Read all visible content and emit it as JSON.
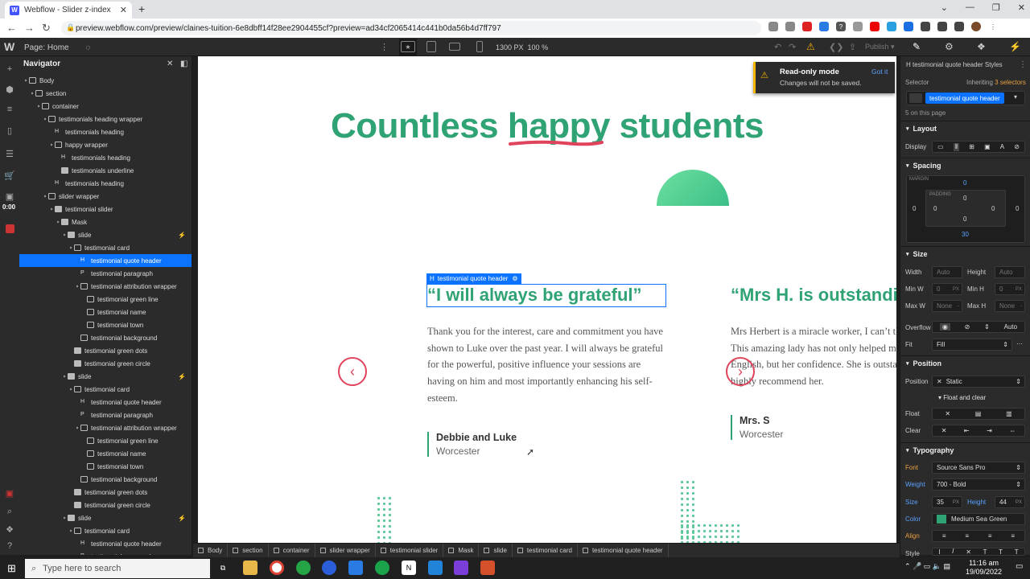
{
  "browser": {
    "tab_title": "Webflow - Slider z-index",
    "url": "preview.webflow.com/preview/claines-tuition-6e8dbff14f28ee2904455cf?preview=ad34cf2065414c441b0da56b4d7ff797"
  },
  "webflow": {
    "page_prefix": "Page:",
    "page_name": "Home",
    "viewport_width": "1300 PX",
    "zoom": "100 %",
    "publish": "Publish",
    "timer": "0:00"
  },
  "navigator": {
    "title": "Navigator",
    "rows": [
      {
        "label": "Body",
        "depth": 0,
        "icon": "box",
        "tw": "▾"
      },
      {
        "label": "section",
        "depth": 1,
        "icon": "box",
        "tw": "▾"
      },
      {
        "label": "container",
        "depth": 2,
        "icon": "box",
        "tw": "▾"
      },
      {
        "label": "testimonials heading wrapper",
        "depth": 3,
        "icon": "box",
        "tw": "▾"
      },
      {
        "label": "testimonials heading",
        "depth": 4,
        "icon": "H",
        "tw": ""
      },
      {
        "label": "happy wrapper",
        "depth": 4,
        "icon": "box",
        "tw": "▾"
      },
      {
        "label": "testimonials heading",
        "depth": 5,
        "icon": "H",
        "tw": ""
      },
      {
        "label": "testimonials underline",
        "depth": 5,
        "icon": "img",
        "tw": ""
      },
      {
        "label": "testimonials heading",
        "depth": 4,
        "icon": "H",
        "tw": ""
      },
      {
        "label": "slider wrapper",
        "depth": 3,
        "icon": "box",
        "tw": "▾"
      },
      {
        "label": "testimonial slider",
        "depth": 4,
        "icon": "img",
        "tw": "▾"
      },
      {
        "label": "Mask",
        "depth": 5,
        "icon": "img",
        "tw": "▾"
      },
      {
        "label": "slide",
        "depth": 6,
        "icon": "img",
        "tw": "▾",
        "bolt": true
      },
      {
        "label": "testimonial card",
        "depth": 7,
        "icon": "box",
        "tw": "▾"
      },
      {
        "label": "testimonial quote header",
        "depth": 8,
        "icon": "H",
        "tw": "",
        "sel": true
      },
      {
        "label": "testimonial paragraph",
        "depth": 8,
        "icon": "P",
        "tw": ""
      },
      {
        "label": "testimonial attribution wrapper",
        "depth": 8,
        "icon": "box",
        "tw": "▾"
      },
      {
        "label": "testimonial green line",
        "depth": 9,
        "icon": "box",
        "tw": ""
      },
      {
        "label": "testimonial name",
        "depth": 9,
        "icon": "box",
        "tw": ""
      },
      {
        "label": "testimonial town",
        "depth": 9,
        "icon": "box",
        "tw": ""
      },
      {
        "label": "testimonial background",
        "depth": 8,
        "icon": "box",
        "tw": ""
      },
      {
        "label": "testimonial green dots",
        "depth": 7,
        "icon": "img",
        "tw": ""
      },
      {
        "label": "testimonial green circle",
        "depth": 7,
        "icon": "img",
        "tw": ""
      },
      {
        "label": "slide",
        "depth": 6,
        "icon": "img",
        "tw": "▾",
        "bolt": true
      },
      {
        "label": "testimonial card",
        "depth": 7,
        "icon": "box",
        "tw": "▾"
      },
      {
        "label": "testimonial quote header",
        "depth": 8,
        "icon": "H",
        "tw": ""
      },
      {
        "label": "testimonial paragraph",
        "depth": 8,
        "icon": "P",
        "tw": ""
      },
      {
        "label": "testimonial attribution wrapper",
        "depth": 8,
        "icon": "box",
        "tw": "▾"
      },
      {
        "label": "testimonial green line",
        "depth": 9,
        "icon": "box",
        "tw": ""
      },
      {
        "label": "testimonial name",
        "depth": 9,
        "icon": "box",
        "tw": ""
      },
      {
        "label": "testimonial town",
        "depth": 9,
        "icon": "box",
        "tw": ""
      },
      {
        "label": "testimonial background",
        "depth": 8,
        "icon": "box",
        "tw": ""
      },
      {
        "label": "testimonial green dots",
        "depth": 7,
        "icon": "img",
        "tw": ""
      },
      {
        "label": "testimonial green circle",
        "depth": 7,
        "icon": "img",
        "tw": ""
      },
      {
        "label": "slide",
        "depth": 6,
        "icon": "img",
        "tw": "▾",
        "bolt": true
      },
      {
        "label": "testimonial card",
        "depth": 7,
        "icon": "box",
        "tw": "▾"
      },
      {
        "label": "testimonial quote header",
        "depth": 8,
        "icon": "H",
        "tw": ""
      },
      {
        "label": "testimonial paragraph",
        "depth": 8,
        "icon": "P",
        "tw": ""
      }
    ]
  },
  "toast": {
    "title": "Read-only mode",
    "body": "Changes will not be saved.",
    "action": "Got it"
  },
  "page": {
    "heading_before": "Countless ",
    "heading_happy": "happy",
    "heading_after": " students",
    "selected_label": "testimonial quote header",
    "card1": {
      "quote": "“I will always be grateful”",
      "paragraph": "Thank you for the interest, care and commitment you have shown to Luke over the past year. I will always be grateful for the powerful, positive influence your sessions are having on him and most importantly enhancing his self-esteem.",
      "name": "Debbie and Luke",
      "town": "Worcester"
    },
    "card2": {
      "quote": "“Mrs H. is outstanding”",
      "paragraph": "Mrs Herbert is a miracle worker, I can’t thank her enough. This amazing lady has not only helped my daughter’s English, but her confidence. She is outstanding and I can highly recommend her.",
      "name": "Mrs. S",
      "town": "Worcester"
    },
    "prev_arrow": "‹",
    "next_arrow": "›"
  },
  "breadcrumb": [
    "Body",
    "section",
    "container",
    "slider wrapper",
    "testimonial slider",
    "Mask",
    "slide",
    "testimonial card",
    "testimonial quote header"
  ],
  "style_panel": {
    "element_title": "testimonial quote header Styles",
    "selector_label": "Selector",
    "inheriting": "Inheriting",
    "inheriting_count": "3 selectors",
    "selector_value": "testimonial quote header",
    "on_page": "5 on this page",
    "layout": "Layout",
    "display": "Display",
    "spacing": "Spacing",
    "margin": "MARGIN",
    "padding": "PADDING",
    "margin_top": "0",
    "margin_left": "0",
    "margin_right": "0",
    "margin_bottom": "30",
    "padding_top": "0",
    "padding_left": "0",
    "padding_right": "0",
    "padding_bottom": "0",
    "size": "Size",
    "width": "Width",
    "height": "Height",
    "auto": "Auto",
    "minw": "Min W",
    "minh": "Min H",
    "maxw": "Max W",
    "maxh": "Max H",
    "zero": "0",
    "px": "PX",
    "none": "None",
    "overflow": "Overflow",
    "overflow_auto": "Auto",
    "fit": "Fit",
    "fit_value": "Fill",
    "position_h": "Position",
    "position": "Position",
    "position_value": "Static",
    "float_clear": "Float and clear",
    "float": "Float",
    "clear": "Clear",
    "typography": "Typography",
    "font": "Font",
    "font_value": "Source Sans Pro",
    "weight": "Weight",
    "weight_value": "700 - Bold",
    "size_l": "Size",
    "size_value": "35",
    "lh": "Height",
    "lh_value": "44",
    "color": "Color",
    "color_value": "Medium Sea Green",
    "align": "Align",
    "style": "Style"
  },
  "taskbar": {
    "search_placeholder": "Type here to search",
    "time": "11:16 am",
    "date": "19/09/2022"
  },
  "colors": {
    "accent": "#2fa374",
    "selection": "#0b73ff",
    "arrow": "#e0435c",
    "warning": "#f5b400"
  }
}
